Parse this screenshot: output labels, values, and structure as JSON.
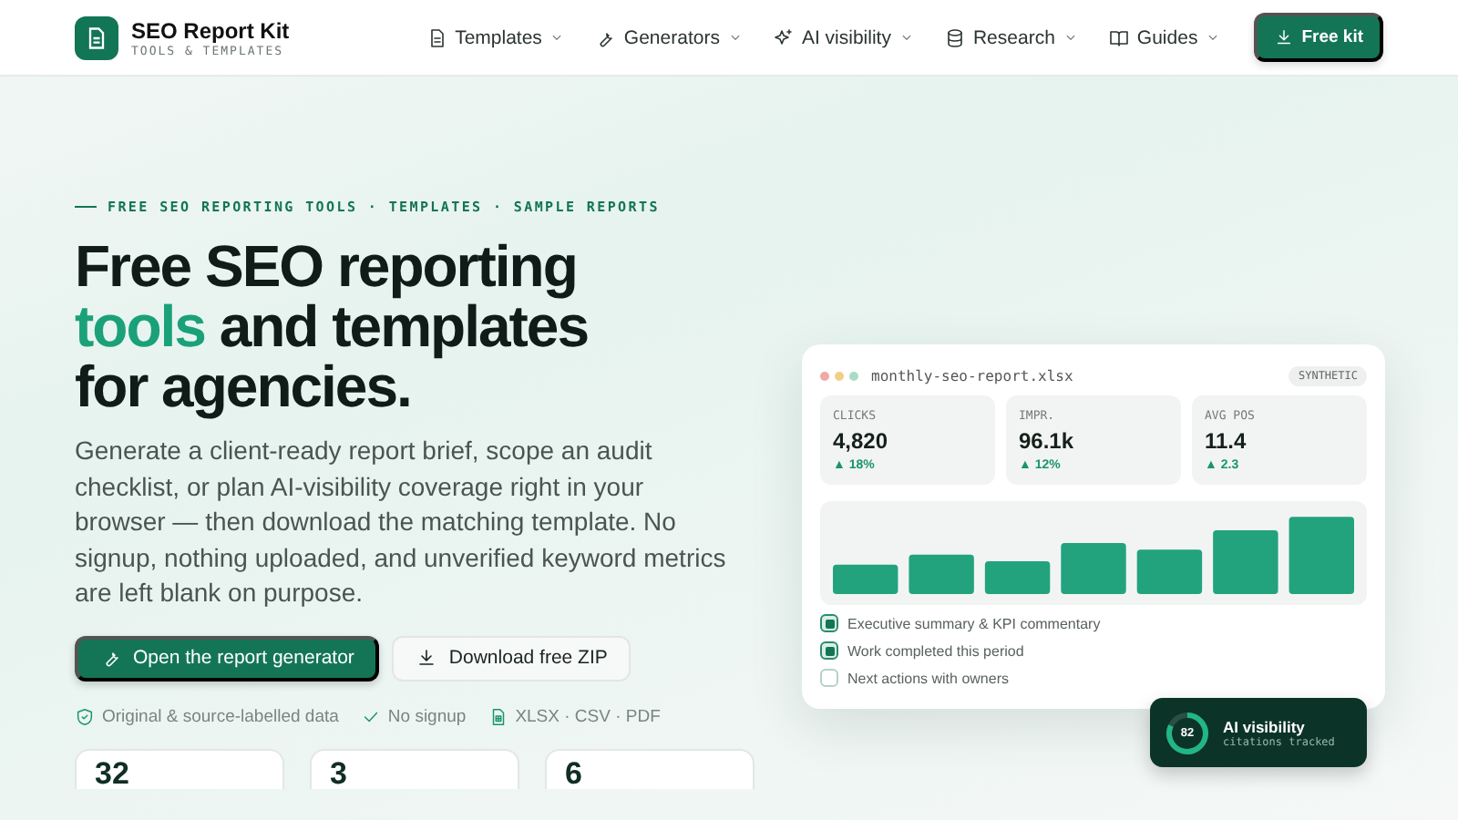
{
  "brand": {
    "name": "SEO Report Kit",
    "tagline": "TOOLS & TEMPLATES"
  },
  "nav": [
    {
      "label": "Templates"
    },
    {
      "label": "Generators"
    },
    {
      "label": "AI visibility"
    },
    {
      "label": "Research"
    },
    {
      "label": "Guides"
    }
  ],
  "cta": {
    "label": "Free kit"
  },
  "eyebrow": "FREE SEO REPORTING TOOLS · TEMPLATES · SAMPLE REPORTS",
  "headline": [
    {
      "text": "Free SEO reporting",
      "accent": false
    },
    {
      "text": "tools",
      "accent": true
    },
    {
      "text": "and templates for agencies.",
      "accent": false
    }
  ],
  "intro": "Generate a client-ready report brief, scope an audit checklist, or plan AI-visibility coverage right in your browser — then download the matching template. No signup, nothing uploaded, and unverified keyword metrics are left blank on purpose.",
  "buttons": [
    {
      "label": "Open the report generator",
      "kind": "primary"
    },
    {
      "label": "Download free ZIP",
      "kind": "secondary"
    }
  ],
  "features": [
    {
      "label": "Original & source-labelled data"
    },
    {
      "label": "No signup"
    },
    {
      "label": "XLSX · CSV · PDF"
    }
  ],
  "stats": [
    "32",
    "3",
    "6"
  ],
  "preview": {
    "filename": "monthly-seo-report.xlsx",
    "badge": "SYNTHETIC",
    "kpis": [
      {
        "label": "CLICKS",
        "value": "4,820",
        "change": "▲ 18%"
      },
      {
        "label": "IMPR.",
        "value": "96.1k",
        "change": "▲ 12%"
      },
      {
        "label": "AVG POS",
        "value": "11.4",
        "change": "▲ 2.3"
      }
    ],
    "checklist": [
      {
        "label": "Executive summary & KPI commentary",
        "checked": true
      },
      {
        "label": "Work completed this period",
        "checked": true
      },
      {
        "label": "Next actions with owners",
        "checked": false
      }
    ],
    "ai_badge": {
      "score": "82",
      "level": 0.82,
      "title": "AI visibility",
      "subtitle": "citations tracked"
    }
  }
}
